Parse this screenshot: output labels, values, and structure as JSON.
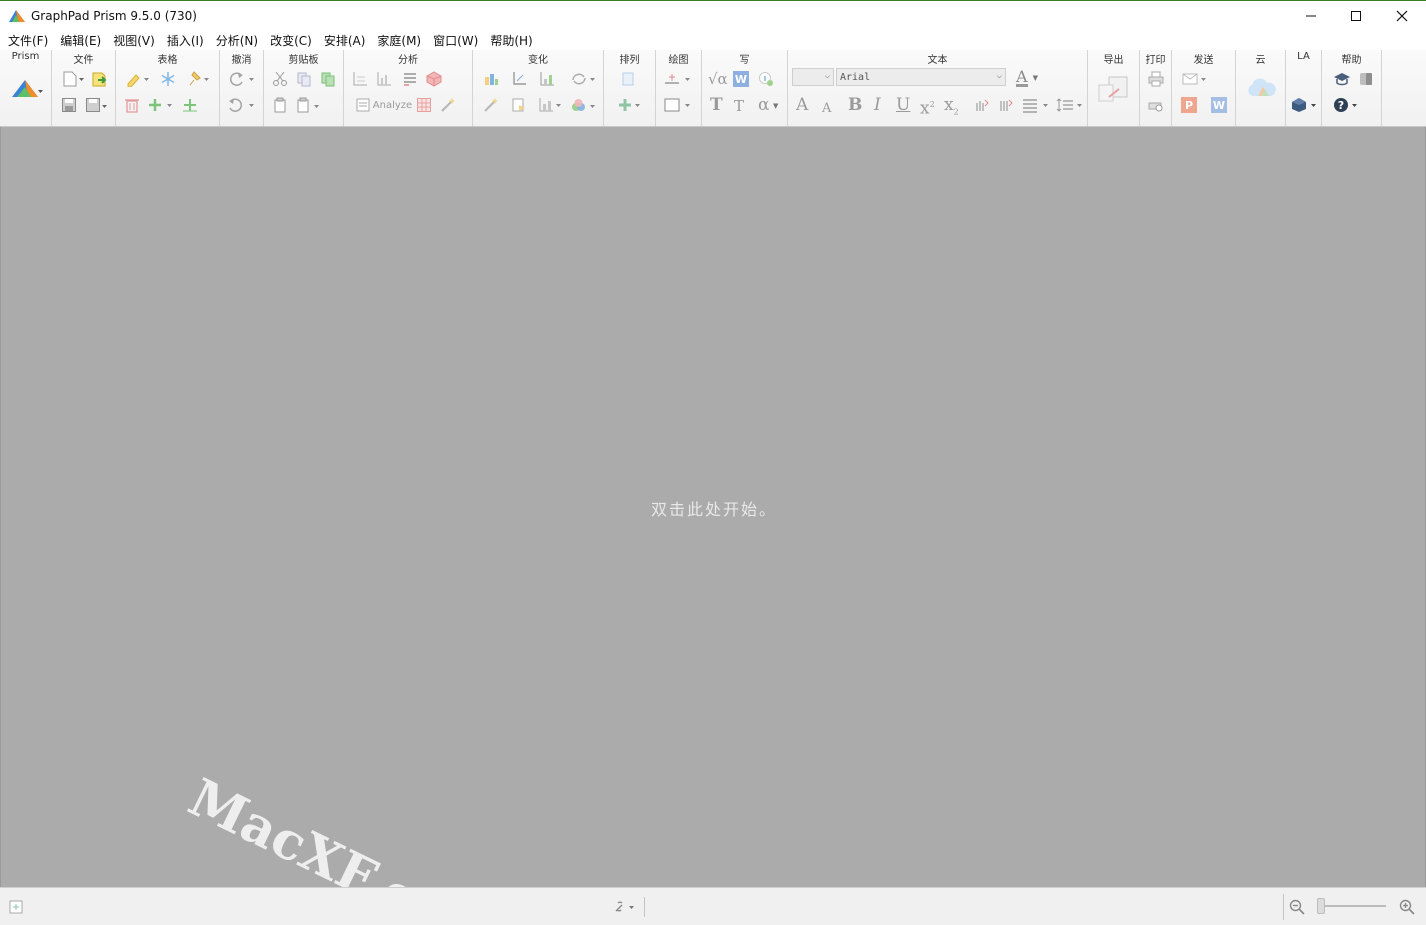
{
  "window": {
    "title": "GraphPad Prism 9.5.0 (730)",
    "controls": [
      "minimize-icon",
      "maximize-icon",
      "close-icon"
    ]
  },
  "menu": [
    {
      "label": "文件(F)"
    },
    {
      "label": "编辑(E)"
    },
    {
      "label": "视图(V)"
    },
    {
      "label": "插入(I)"
    },
    {
      "label": "分析(N)"
    },
    {
      "label": "改变(C)"
    },
    {
      "label": "安排(A)"
    },
    {
      "label": "家庭(M)"
    },
    {
      "label": "窗口(W)"
    },
    {
      "label": "帮助(H)"
    }
  ],
  "ribbon": {
    "groups": {
      "prism": "Prism",
      "file": "文件",
      "sheet": "表格",
      "undo": "撤消",
      "clipboard": "剪贴板",
      "analysis": "分析",
      "change": "变化",
      "arrange": "排列",
      "draw": "绘图",
      "write": "写",
      "text": "文本",
      "export": "导出",
      "print": "打印",
      "send": "发送",
      "cloud": "云",
      "la": "LA",
      "help": "帮助"
    },
    "analyze_label": "Analyze",
    "font_size_value": "",
    "font_name_value": "Arial",
    "text_icons": {
      "sqrt": "√α",
      "word": "W",
      "big_t": "T",
      "small_t": "T",
      "alpha": "α",
      "grow_font": "A",
      "shrink_font": "A",
      "bold": "B",
      "italic": "I",
      "underline": "U",
      "superscript": "x",
      "subscript": "x",
      "font_color": "A",
      "powerpoint": "P",
      "word_send": "W"
    }
  },
  "workspace": {
    "hint": "双击此处开始。",
    "watermark": "MacXF.com"
  },
  "colors": {
    "workspace_bg": "#ababab",
    "ribbon_bg": "#f4f4f4",
    "accent_green": "#3a7d2c"
  }
}
